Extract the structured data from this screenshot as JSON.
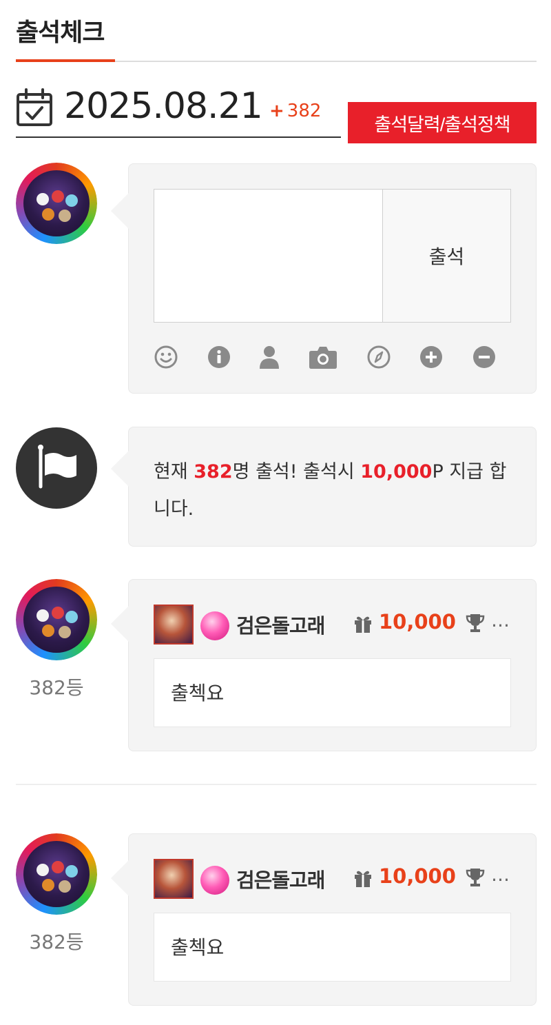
{
  "header": {
    "title": "출석체크"
  },
  "date_bar": {
    "date": "2025.08.21",
    "count_plus": "+",
    "count": "382"
  },
  "policy_button": {
    "label": "출석달력/출석정책"
  },
  "composer": {
    "submit_label": "출석",
    "tools": [
      "smile-icon",
      "info-icon",
      "user-icon",
      "camera-icon",
      "compass-icon",
      "plus-circle-icon",
      "minus-circle-icon"
    ]
  },
  "notice": {
    "prefix": "현재 ",
    "count": "382",
    "middle": "명 출석! 출석시 ",
    "points": "10,000",
    "suffix": "P 지급 합니다."
  },
  "entries": [
    {
      "username": "검은돌고래",
      "points": "10,000",
      "ellipsis": "…",
      "message": "출첵요",
      "rank": "382등"
    },
    {
      "username": "검은돌고래",
      "points": "10,000",
      "ellipsis": "…",
      "message": "출첵요",
      "rank": "382등"
    }
  ],
  "colors": {
    "accent": "#e8411a",
    "button_red": "#e8202a",
    "bubble_bg": "#f4f4f4",
    "text": "#333333"
  }
}
